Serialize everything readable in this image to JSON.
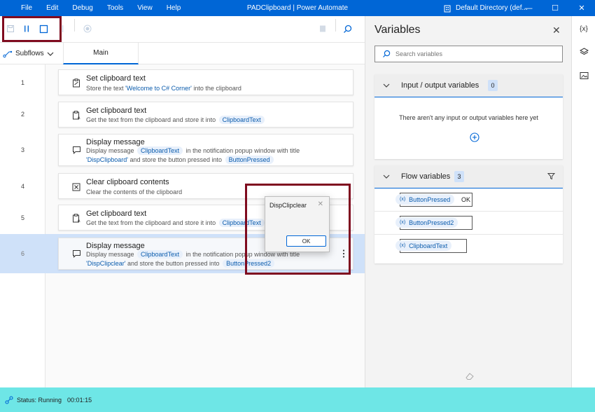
{
  "titlebar": {
    "menus": [
      "File",
      "Edit",
      "Debug",
      "Tools",
      "View",
      "Help"
    ],
    "app_title": "PADClipboard | Power Automate",
    "directory": "Default Directory (def...",
    "win_minimize": "—",
    "win_maximize": "☐",
    "win_close": "✕"
  },
  "tabs": {
    "subflows_label": "Subflows",
    "main_label": "Main"
  },
  "steps": [
    {
      "num": "1",
      "title": "Set clipboard text",
      "desc_pre": "Store the text ",
      "desc_lit": "'Welcome to C# Corner'",
      "desc_post": " into the clipboard"
    },
    {
      "num": "2",
      "title": "Get clipboard text",
      "desc_pre": "Get the text from the clipboard and store it into",
      "token": "ClipboardText"
    },
    {
      "num": "3",
      "title": "Display message",
      "line1_pre": "Display message",
      "token1": "ClipboardText",
      "line1_post": "in the notification popup window with title",
      "line2_lit": "'DispClipboard'",
      "line2_mid": " and store the button pressed into",
      "token2": "ButtonPressed"
    },
    {
      "num": "4",
      "title": "Clear clipboard contents",
      "desc": "Clear the contents of the clipboard"
    },
    {
      "num": "5",
      "title": "Get clipboard text",
      "desc_pre": "Get the text from the clipboard and store it into",
      "token": "ClipboardText"
    },
    {
      "num": "6",
      "title": "Display message",
      "line1_pre": "Display message",
      "token1": "ClipboardText",
      "line1_post": "in the notification popup window with title",
      "line2_lit": "'DispClipclear'",
      "line2_mid": " and store the button pressed into",
      "token2": "ButtonPressed2"
    }
  ],
  "dialog": {
    "title": "DispClipclear",
    "close": "✕",
    "ok": "OK"
  },
  "variables": {
    "title": "Variables",
    "close": "✕",
    "search_placeholder": "Search variables",
    "io_section": {
      "title": "Input / output variables",
      "count": "0",
      "empty": "There aren't any input or output variables here yet"
    },
    "flow_section": {
      "title": "Flow variables",
      "count": "3",
      "items": [
        {
          "name": "ButtonPressed",
          "value": "OK"
        },
        {
          "name": "ButtonPressed2",
          "value": ""
        },
        {
          "name": "ClipboardText",
          "value": ""
        }
      ]
    },
    "var_prefix": "(x)"
  },
  "rail": {
    "variables_label": "{x}"
  },
  "status": {
    "label": "Status: Running",
    "time": "00:01:15"
  },
  "colors": {
    "titlebar": "#0066d6",
    "highlight": "#7f0b1f",
    "statusbar": "#6ee6e6",
    "selected_row": "#cfe1f9"
  }
}
